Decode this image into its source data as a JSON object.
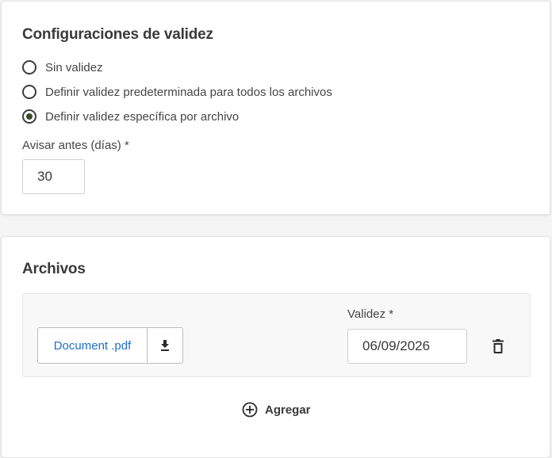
{
  "validity_settings": {
    "title": "Configuraciones de validez",
    "options": [
      {
        "label": "Sin validez",
        "selected": false
      },
      {
        "label": "Definir validez predeterminada para todos los archivos",
        "selected": false
      },
      {
        "label": "Definir validez específica por archivo",
        "selected": true
      }
    ],
    "notify_before": {
      "label": "Avisar antes (días) *",
      "value": "30"
    }
  },
  "files": {
    "title": "Archivos",
    "items": [
      {
        "file_name": "Document .pdf",
        "validity_label": "Validez *",
        "validity_date": "06/09/2026"
      }
    ],
    "add_label": "Agregar"
  },
  "icons": {
    "download": "download-icon",
    "delete": "trash-icon",
    "add": "add-circle-icon"
  },
  "colors": {
    "accent_link": "#1f6fc5",
    "radio_selected": "#3b4a2c"
  }
}
